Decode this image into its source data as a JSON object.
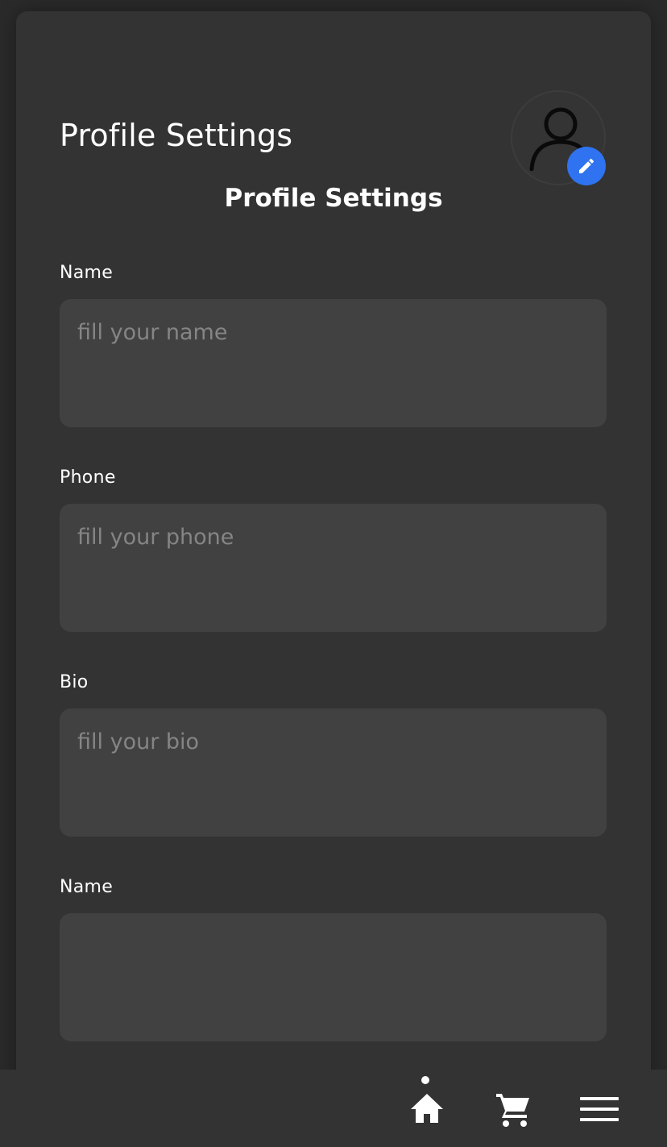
{
  "header": {
    "title": "Profile Settings"
  },
  "profile": {
    "avatar_icon": "person-outline-icon",
    "edit_icon": "pencil-icon",
    "edit_badge_color": "#2f73f0"
  },
  "form": {
    "title": "Profile Settings",
    "fields": [
      {
        "label": "Name",
        "placeholder": "fill your name",
        "value": ""
      },
      {
        "label": "Phone",
        "placeholder": "fill your phone",
        "value": ""
      },
      {
        "label": "Bio",
        "placeholder": "fill your bio",
        "value": ""
      },
      {
        "label": "Name",
        "placeholder": "",
        "value": ""
      }
    ]
  },
  "bottom_nav": {
    "items": [
      {
        "icon": "home-icon",
        "active": true
      },
      {
        "icon": "cart-icon",
        "active": false
      },
      {
        "icon": "menu-icon",
        "active": false
      }
    ]
  }
}
